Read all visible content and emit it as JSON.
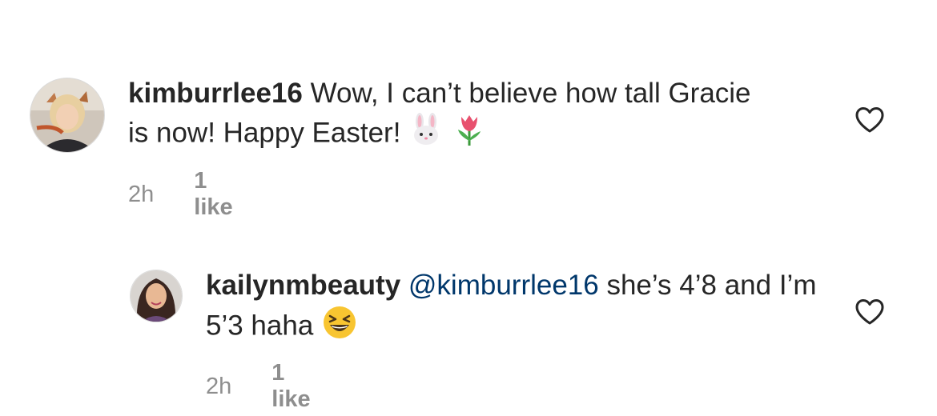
{
  "comments": [
    {
      "username": "kimburrlee16",
      "mention": "",
      "text": "Wow, I can’t believe how tall Gracie is now! Happy Easter!",
      "emojis": [
        "bunny-face-emoji",
        "tulip-emoji"
      ],
      "time": "2h",
      "likes": "1 like",
      "avatar_icon": "profile-photo-kimburrlee16"
    },
    {
      "username": "kailynmbeauty",
      "mention": "@kimburrlee16",
      "text": "she’s 4’8 and I’m 5’3 haha",
      "emojis": [
        "grinning-squinting-face-emoji"
      ],
      "time": "2h",
      "likes": "1 like",
      "avatar_icon": "profile-photo-kailynmbeauty"
    }
  ],
  "colors": {
    "text": "#262626",
    "secondary": "#8e8e8e",
    "mention": "#00376b"
  }
}
